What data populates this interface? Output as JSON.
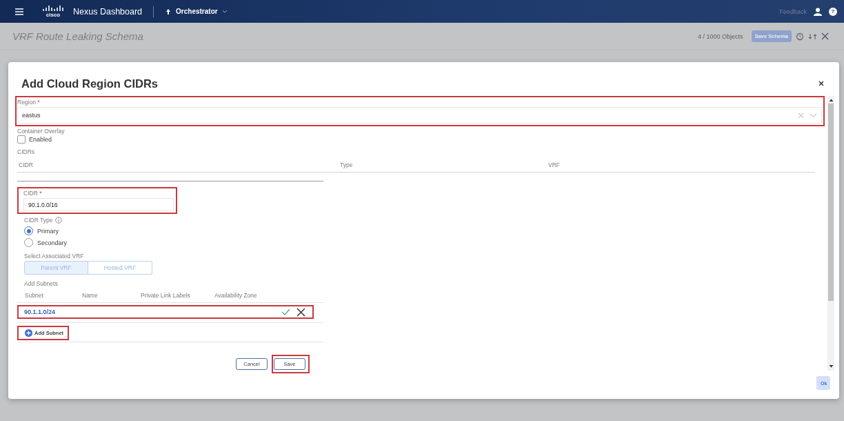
{
  "top_bar": {
    "logo_text": "cisco",
    "brand": "Nexus Dashboard",
    "app_switcher": "Orchestrator",
    "feedback": "Feedback",
    "help": "?"
  },
  "page": {
    "title": "VRF Route Leaking Schema",
    "object_count": "4 / 1000 Objects",
    "save_button": "Save Schema"
  },
  "dialog": {
    "title": "Add Cloud Region CIDRs",
    "region": {
      "label": "Region",
      "required_mark": "*",
      "value": "eastus",
      "highlighted": true
    },
    "container_overlay": {
      "label": "Container Overlay",
      "option": "Enabled",
      "checked": false
    },
    "cidrs": {
      "label": "CIDRs",
      "columns": [
        "CIDR",
        "Type",
        "VRF"
      ]
    },
    "cidr_form": {
      "cidr": {
        "label": "CIDR",
        "required_mark": "*",
        "value": "90.1.0.0/16",
        "highlighted": true
      },
      "cidr_type": {
        "label": "CIDR Type",
        "options": [
          {
            "label": "Primary",
            "selected": true
          },
          {
            "label": "Secondary",
            "selected": false
          }
        ]
      },
      "vrf": {
        "label": "Select Associated VRF",
        "options": [
          {
            "label": "Parent VRF",
            "selected": true
          },
          {
            "label": "Hosted VRF",
            "selected": false
          }
        ]
      },
      "subnets": {
        "label": "Add Subnets",
        "columns": [
          "Subnet",
          "Name",
          "Private Link Labels",
          "Availability Zone"
        ],
        "rows": [
          {
            "subnet": "90.1.1.0/24",
            "highlighted": true
          }
        ],
        "add_button": {
          "label": "Add Subnet",
          "highlighted": true
        }
      },
      "buttons": [
        {
          "label": "Cancel",
          "highlighted": false
        },
        {
          "label": "Save",
          "highlighted": true
        }
      ]
    },
    "ok_button": {
      "label": "Ok",
      "disabled": true
    }
  }
}
